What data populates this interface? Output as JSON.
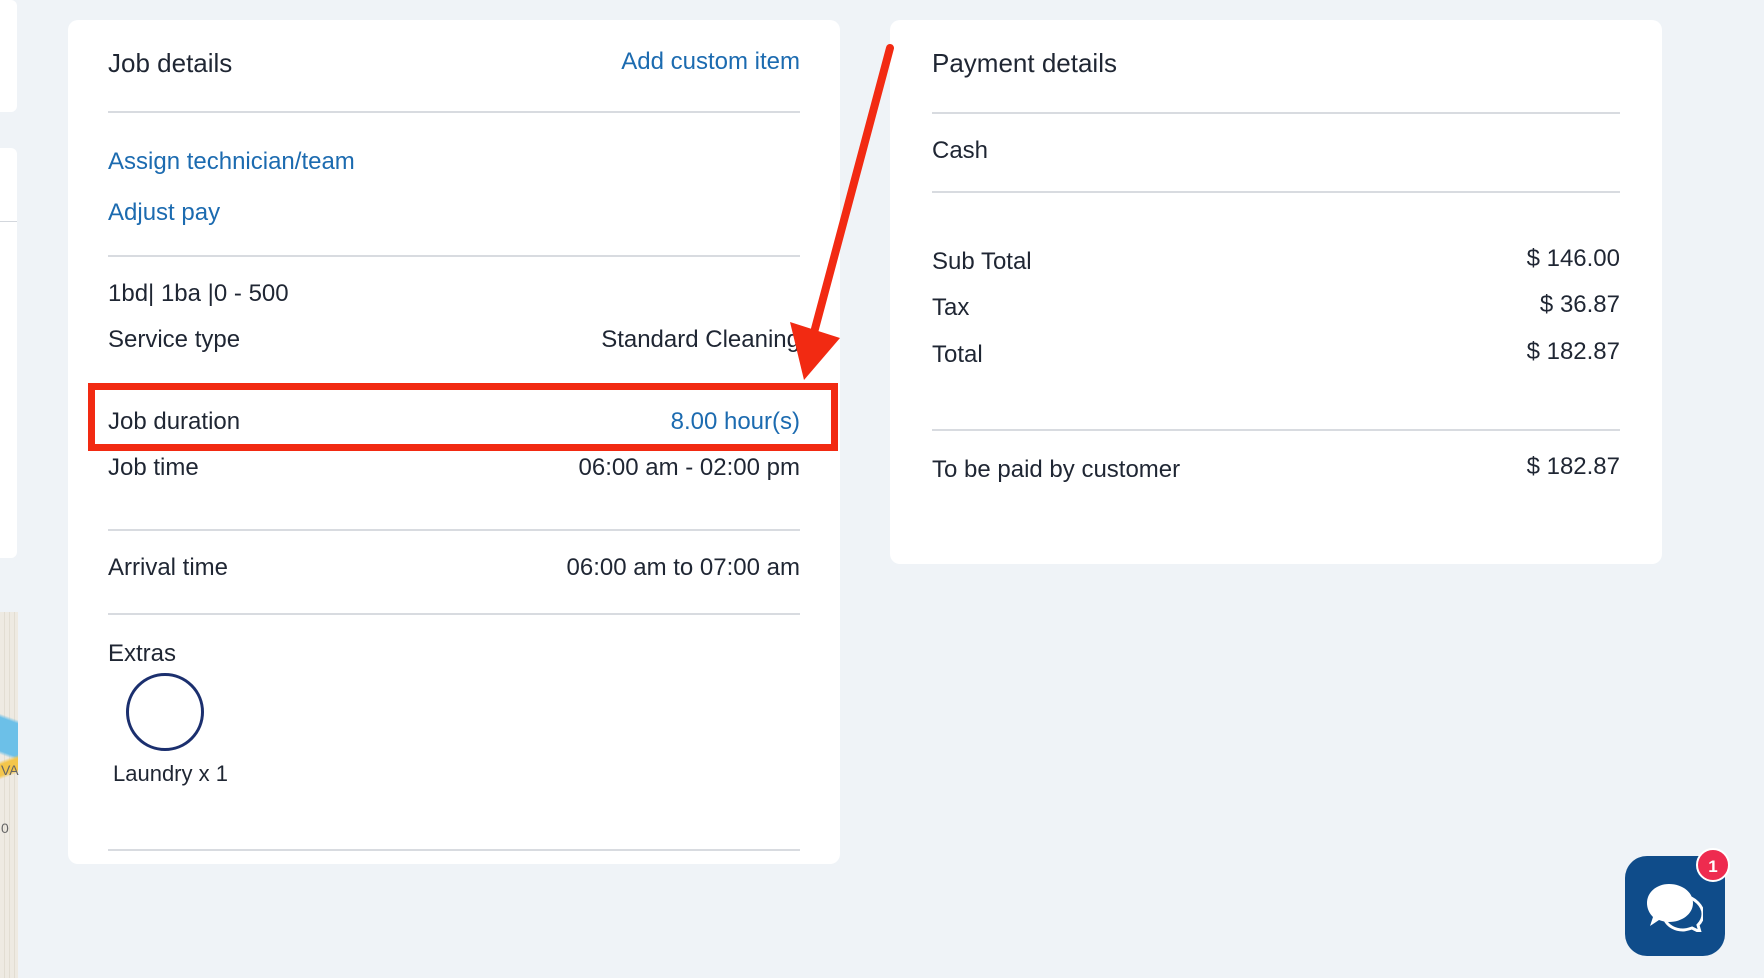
{
  "job_details": {
    "title": "Job details",
    "add_custom_item": "Add custom item",
    "assign_technician": "Assign technician/team",
    "adjust_pay": "Adjust pay",
    "property_summary": "1bd| 1ba |0 - 500",
    "service_type_label": "Service type",
    "service_type_value": "Standard Cleaning",
    "job_duration_label": "Job duration",
    "job_duration_value": "8.00 hour(s)",
    "job_time_label": "Job time",
    "job_time_value": "06:00 am - 02:00 pm",
    "arrival_time_label": "Arrival time",
    "arrival_time_value": "06:00 am to 07:00 am",
    "extras_label": "Extras",
    "extras": [
      {
        "name": "Laundry x 1"
      }
    ]
  },
  "payment_details": {
    "title": "Payment details",
    "method": "Cash",
    "sub_total_label": "Sub Total",
    "sub_total_value": "$ 146.00",
    "tax_label": "Tax",
    "tax_value": "$ 36.87",
    "total_label": "Total",
    "total_value": "$ 182.87",
    "to_be_paid_label": "To be paid by customer",
    "to_be_paid_value": "$ 182.87"
  },
  "chat": {
    "badge_count": "1",
    "icon": "chat-bubbles-icon"
  },
  "map_edge": {
    "label_1": "VA",
    "label_2": "0"
  },
  "colors": {
    "link": "#1c6bb0",
    "highlight": "#f22a12",
    "chat_button": "#0f4c8a",
    "badge": "#ee2b4f"
  }
}
